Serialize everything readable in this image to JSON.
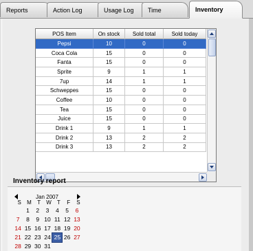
{
  "tabs": [
    {
      "label": "Reports"
    },
    {
      "label": "Action Log"
    },
    {
      "label": "Usage Log"
    },
    {
      "label": "Time"
    },
    {
      "label": "Inventory",
      "active": true
    }
  ],
  "grid": {
    "columns": [
      "POS Item",
      "On stock",
      "Sold total",
      "Sold today"
    ],
    "rows": [
      [
        "Pepsi",
        "10",
        "0",
        "0"
      ],
      [
        "Coca Cola",
        "15",
        "0",
        "0"
      ],
      [
        "Fanta",
        "15",
        "0",
        "0"
      ],
      [
        "Sprite",
        "9",
        "1",
        "1"
      ],
      [
        "7up",
        "14",
        "1",
        "1"
      ],
      [
        "Schweppes",
        "15",
        "0",
        "0"
      ],
      [
        "Coffee",
        "10",
        "0",
        "0"
      ],
      [
        "Tea",
        "15",
        "0",
        "0"
      ],
      [
        "Juice",
        "15",
        "0",
        "0"
      ],
      [
        "Drink 1",
        "9",
        "1",
        "1"
      ],
      [
        "Drink 2",
        "13",
        "2",
        "2"
      ],
      [
        "Drink 3",
        "13",
        "2",
        "2"
      ]
    ],
    "selected_row": 0
  },
  "report": {
    "title": "Inventory report"
  },
  "calendar": {
    "month_label": "Jan 2007",
    "weekdays": [
      "S",
      "M",
      "T",
      "W",
      "T",
      "F",
      "S"
    ],
    "weeks": [
      [
        "",
        "1",
        "2",
        "3",
        "4",
        "5",
        "6"
      ],
      [
        "7",
        "8",
        "9",
        "10",
        "11",
        "12",
        "13"
      ],
      [
        "14",
        "15",
        "16",
        "17",
        "18",
        "19",
        "20"
      ],
      [
        "21",
        "22",
        "23",
        "24",
        "25",
        "26",
        "27"
      ],
      [
        "28",
        "29",
        "30",
        "31",
        "",
        "",
        ""
      ]
    ],
    "today": "25",
    "weekend_color": "#c00000",
    "selected_color": "#3d5fa6"
  },
  "colors": {
    "selection": "#316ac5"
  }
}
